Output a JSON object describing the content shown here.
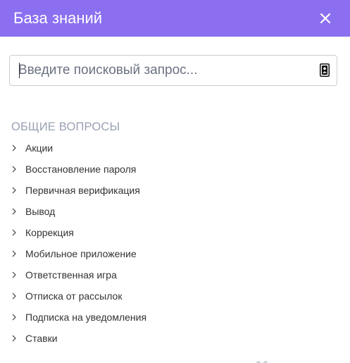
{
  "header": {
    "title": "База знаний",
    "close_icon": "close-icon"
  },
  "search": {
    "placeholder": "Введите поисковый запрос...",
    "value": "",
    "icon": "contact-card-icon"
  },
  "general_section": {
    "title": "ОБЩИЕ ВОПРОСЫ",
    "items": [
      {
        "label": "Акции"
      },
      {
        "label": "Восстановление пароля"
      },
      {
        "label": "Первичная верификация"
      },
      {
        "label": "Вывод"
      },
      {
        "label": "Коррекция"
      },
      {
        "label": "Мобильное приложение"
      },
      {
        "label": "Ответственная игра"
      },
      {
        "label": "Отписка от рассылок"
      },
      {
        "label": "Подписка на уведомления"
      },
      {
        "label": "Ставки"
      }
    ]
  },
  "colors": {
    "header_bg": "#8b6ff0",
    "section_title": "#9aa1b4",
    "item_text": "#333333"
  }
}
